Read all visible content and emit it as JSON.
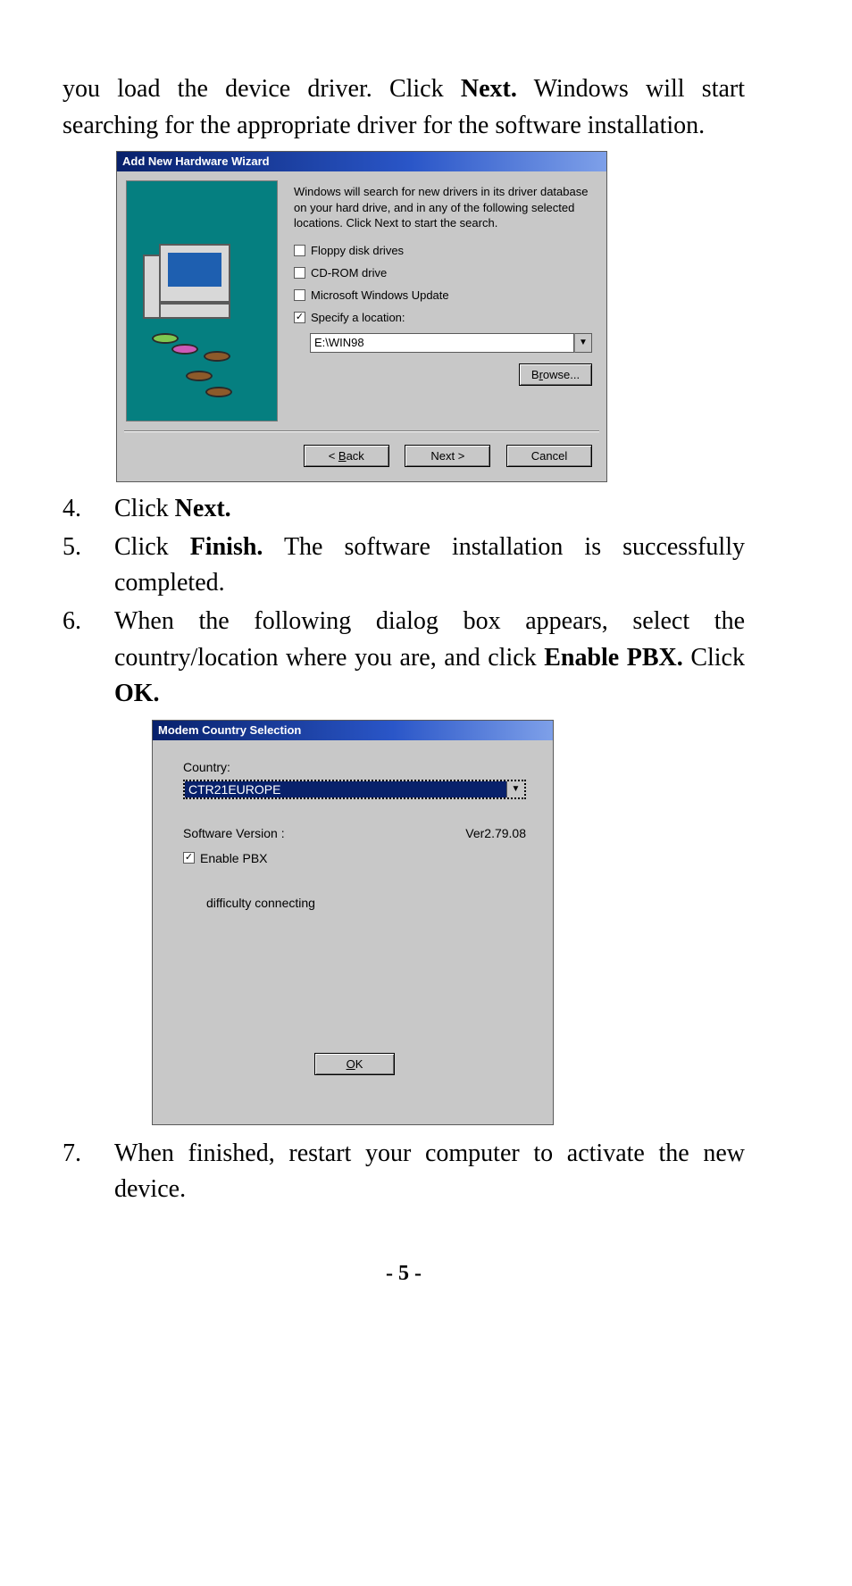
{
  "intro": {
    "pre": "you load the device driver. Click ",
    "next": "Next.",
    "post": " Windows will start searching for the appropriate driver for the software installation."
  },
  "dialog1": {
    "title": "Add New Hardware Wizard",
    "desc": "Windows will search for new drivers in its driver database on your hard drive, and in any of the following selected locations. Click Next to start the search.",
    "floppy_label": "Floppy disk drives",
    "cdrom_label": "CD-ROM drive",
    "winupd_label": "Microsoft Windows Update",
    "location_label": "Specify a location:",
    "location_value": "E:\\WIN98",
    "browse": "Browse...",
    "back": "< Back",
    "next": "Next >",
    "cancel": "Cancel"
  },
  "steps": {
    "s4_pre": "Click ",
    "s4_b": "Next.",
    "s5_pre": "Click ",
    "s5_b": "Finish.",
    "s5_post": " The software installation is successfully completed.",
    "s6_pre": "When the following dialog box appears, select the country/location where you are, and click ",
    "s6_b1": "Enable PBX.",
    "s6_mid": "  Click ",
    "s6_b2": "OK.",
    "s7": "When finished, restart your computer to activate the new device."
  },
  "dialog2": {
    "title": "Modem Country Selection",
    "country_label": "Country:",
    "country_value": "CTR21EUROPE",
    "swver_label": "Software Version :",
    "swver_value": "Ver2.79.08",
    "enable_pbx": "Enable PBX",
    "note": "difficulty connecting",
    "ok": "OK"
  },
  "page_number": "- 5 -"
}
